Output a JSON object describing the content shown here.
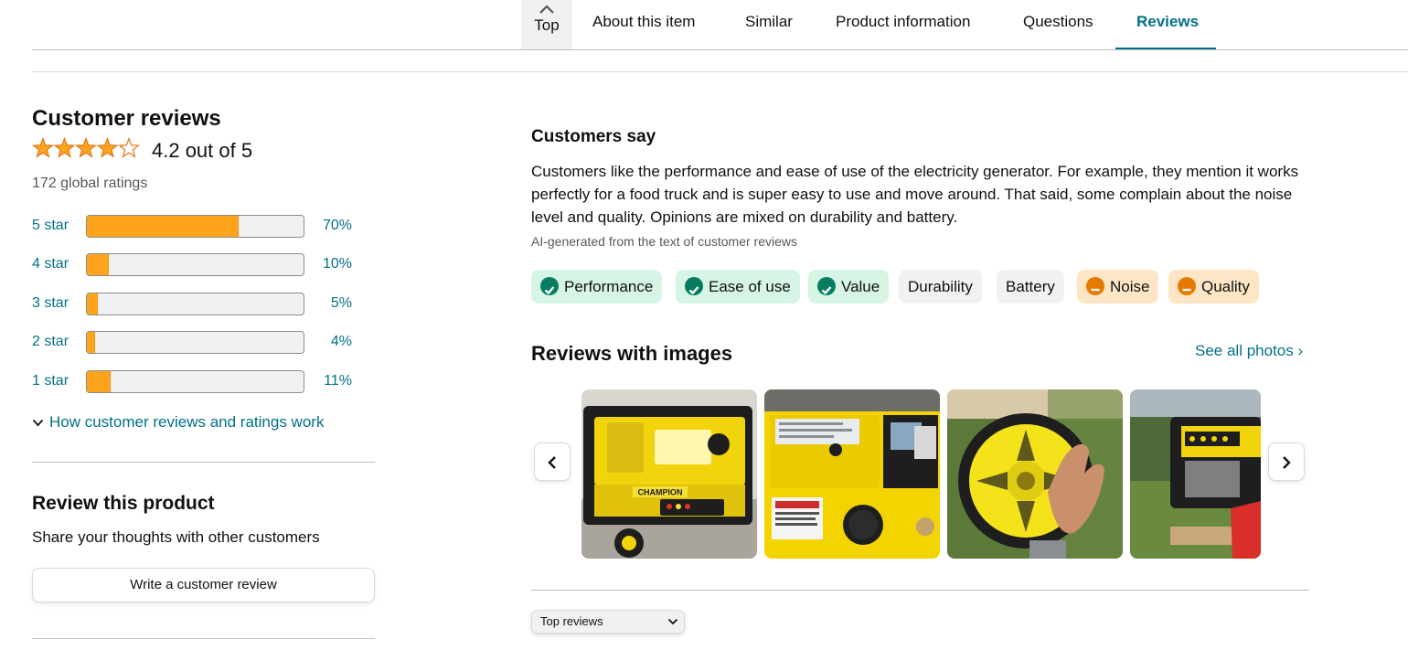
{
  "nav": {
    "top_label": "Top",
    "tabs": [
      {
        "label": "About this item"
      },
      {
        "label": "Similar"
      },
      {
        "label": "Product information"
      },
      {
        "label": "Questions"
      },
      {
        "label": "Reviews",
        "active": true
      }
    ]
  },
  "reviews": {
    "title": "Customer reviews",
    "rating_value": 4.2,
    "rating_text": "4.2 out of 5",
    "global_ratings": "172 global ratings",
    "histogram": [
      {
        "label": "5 star",
        "percent_text": "70%",
        "percent": 70
      },
      {
        "label": "4 star",
        "percent_text": "10%",
        "percent": 10
      },
      {
        "label": "3 star",
        "percent_text": "5%",
        "percent": 5
      },
      {
        "label": "2 star",
        "percent_text": "4%",
        "percent": 4
      },
      {
        "label": "1 star",
        "percent_text": "11%",
        "percent": 11
      }
    ],
    "how_link": "How customer reviews and ratings work"
  },
  "review_product": {
    "title": "Review this product",
    "subtitle": "Share your thoughts with other customers",
    "button_label": "Write a customer review"
  },
  "customers_say": {
    "title": "Customers say",
    "body": "Customers like the performance and ease of use of the electricity generator. For example, they mention it works perfectly for a food truck and is super easy to use and move around. That said, some complain about the noise level and quality. Opinions are mixed on durability and battery.",
    "ai_note": "AI-generated from the text of customer reviews",
    "chips": [
      {
        "label": "Performance",
        "sentiment": "positive"
      },
      {
        "label": "Ease of use",
        "sentiment": "positive"
      },
      {
        "label": "Value",
        "sentiment": "positive"
      },
      {
        "label": "Durability",
        "sentiment": "mixed"
      },
      {
        "label": "Battery",
        "sentiment": "mixed"
      },
      {
        "label": "Noise",
        "sentiment": "negative"
      },
      {
        "label": "Quality",
        "sentiment": "negative"
      }
    ]
  },
  "reviews_with_images": {
    "title": "Reviews with images",
    "see_all": "See all photos ›",
    "photo_logo_text": "CHAMPION"
  },
  "sort": {
    "selected": "Top reviews"
  },
  "colors": {
    "link": "#007185",
    "star": "#ffa41c",
    "positive": "#067d62",
    "negative": "#e67a00"
  }
}
